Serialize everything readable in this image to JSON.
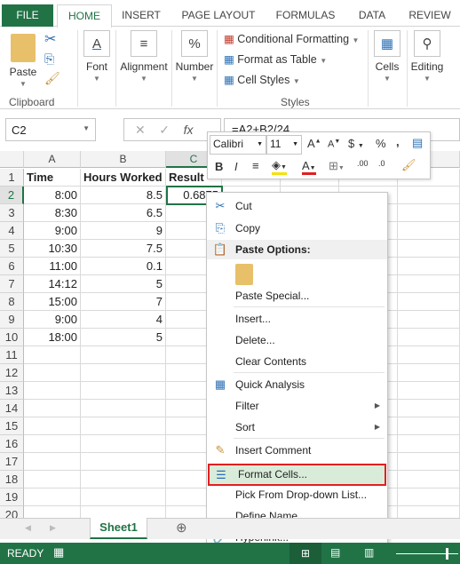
{
  "tabs": [
    "FILE",
    "HOME",
    "INSERT",
    "PAGE LAYOUT",
    "FORMULAS",
    "DATA",
    "REVIEW"
  ],
  "ribbon": {
    "paste": "Paste",
    "clipboard": "Clipboard",
    "font": "Font",
    "alignment": "Alignment",
    "number": "Number",
    "number_icon": "%",
    "conditional": "Conditional Formatting",
    "format_table": "Format as Table",
    "cell_styles": "Cell Styles",
    "styles": "Styles",
    "cells": "Cells",
    "editing": "Editing"
  },
  "formula_bar": {
    "name_box": "C2",
    "formula": "=A2+B2/24",
    "fx": "fx"
  },
  "columns": [
    "A",
    "B",
    "C"
  ],
  "rows": [
    "1",
    "2",
    "3",
    "4",
    "5",
    "6",
    "7",
    "8",
    "9",
    "10",
    "11",
    "12",
    "13",
    "14",
    "15",
    "16",
    "17",
    "18",
    "19",
    "20"
  ],
  "cells": [
    [
      "Time",
      "Hours Worked",
      "Result"
    ],
    [
      "8:00",
      "8.5",
      "0.6875"
    ],
    [
      "8:30",
      "6.5",
      ""
    ],
    [
      "9:00",
      "9",
      ""
    ],
    [
      "10:30",
      "7.5",
      ""
    ],
    [
      "11:00",
      "0.1",
      ""
    ],
    [
      "14:12",
      "5",
      ""
    ],
    [
      "15:00",
      "7",
      ""
    ],
    [
      "9:00",
      "4",
      ""
    ],
    [
      "18:00",
      "5",
      ""
    ]
  ],
  "mini_toolbar": {
    "font": "Calibri",
    "size": "11",
    "currency": "$",
    "percent": "%",
    "comma": ",",
    "bold": "B",
    "italic": "I",
    "font_color": "A",
    "dec_inc": ".00",
    ".0": "",
    "dec_dec": ".0"
  },
  "context_menu": {
    "cut": "Cut",
    "copy": "Copy",
    "paste_options": "Paste Options:",
    "paste_special": "Paste Special...",
    "insert": "Insert...",
    "delete": "Delete...",
    "clear": "Clear Contents",
    "quick": "Quick Analysis",
    "filter": "Filter",
    "sort": "Sort",
    "comment": "Insert Comment",
    "format": "Format Cells...",
    "pick": "Pick From Drop-down List...",
    "define": "Define Name...",
    "hyperlink": "Hyperlink..."
  },
  "sheet_tab": "Sheet1",
  "status": "READY",
  "colors": {
    "accent": "#217346",
    "highlight": "#e02020"
  }
}
